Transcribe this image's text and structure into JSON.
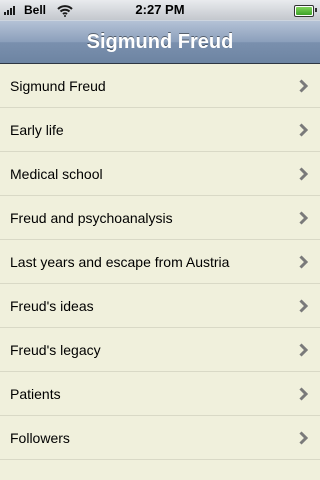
{
  "status_bar": {
    "carrier": "Bell",
    "time": "2:27 PM",
    "battery_level": 1.0
  },
  "nav": {
    "title": "Sigmund Freud"
  },
  "list": {
    "items": [
      {
        "label": "Sigmund Freud",
        "icon": "chevron-right-icon"
      },
      {
        "label": "Early life",
        "icon": "chevron-right-icon"
      },
      {
        "label": "Medical school",
        "icon": "chevron-right-icon"
      },
      {
        "label": "Freud and psychoanalysis",
        "icon": "chevron-right-icon"
      },
      {
        "label": "Last years and escape from Austria",
        "icon": "chevron-right-icon"
      },
      {
        "label": "Freud's ideas",
        "icon": "chevron-right-icon"
      },
      {
        "label": "Freud's legacy",
        "icon": "chevron-right-icon"
      },
      {
        "label": "Patients",
        "icon": "chevron-right-icon"
      },
      {
        "label": "Followers",
        "icon": "chevron-right-icon"
      }
    ]
  },
  "colors": {
    "list_background": "#f0f0dc",
    "chevron": "#7a7a7a"
  }
}
